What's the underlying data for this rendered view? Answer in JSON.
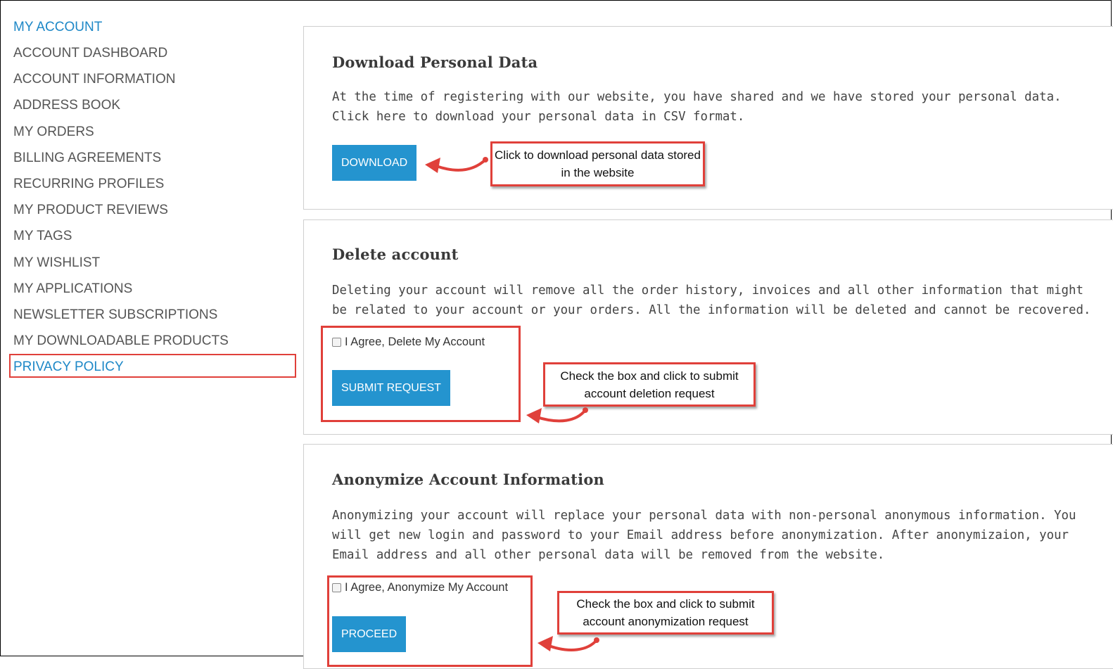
{
  "sidebar": {
    "title": "MY ACCOUNT",
    "items": [
      {
        "label": "ACCOUNT DASHBOARD"
      },
      {
        "label": "ACCOUNT INFORMATION"
      },
      {
        "label": "ADDRESS BOOK"
      },
      {
        "label": "MY ORDERS"
      },
      {
        "label": "BILLING AGREEMENTS"
      },
      {
        "label": "RECURRING PROFILES"
      },
      {
        "label": "MY PRODUCT REVIEWS"
      },
      {
        "label": "MY TAGS"
      },
      {
        "label": "MY WISHLIST"
      },
      {
        "label": "MY APPLICATIONS"
      },
      {
        "label": "NEWSLETTER SUBSCRIPTIONS"
      },
      {
        "label": "MY DOWNLOADABLE PRODUCTS"
      },
      {
        "label": "PRIVACY POLICY"
      }
    ]
  },
  "download": {
    "title": "Download Personal Data",
    "text": "At the time of registering with our website, you have shared and we have stored your personal data. Click here to download your personal data in CSV format.",
    "button": "DOWNLOAD",
    "note": "Click to download personal data stored in the website"
  },
  "delete": {
    "title": "Delete account",
    "text": "Deleting your account will remove all the order history, invoices and all other information that might be related to your account or your orders. All the information will be deleted and cannot be recovered.",
    "checkbox": "I Agree, Delete My Account",
    "button": "SUBMIT REQUEST",
    "note": "Check the box and click to submit account deletion request"
  },
  "anonymize": {
    "title": "Anonymize Account Information",
    "text": "Anonymizing your account will replace your personal data with non-personal anonymous information. You will get new login and password to your Email address before anonymization. After anonymizaion, your Email address and all other personal data will be removed from the website.",
    "checkbox": "I Agree, Anonymize My Account",
    "button": "PROCEED",
    "note": "Check the box and click to submit account anonymization request"
  },
  "colors": {
    "accent": "#2494cf",
    "annotation": "#e0403a",
    "link": "#1e88c7"
  }
}
